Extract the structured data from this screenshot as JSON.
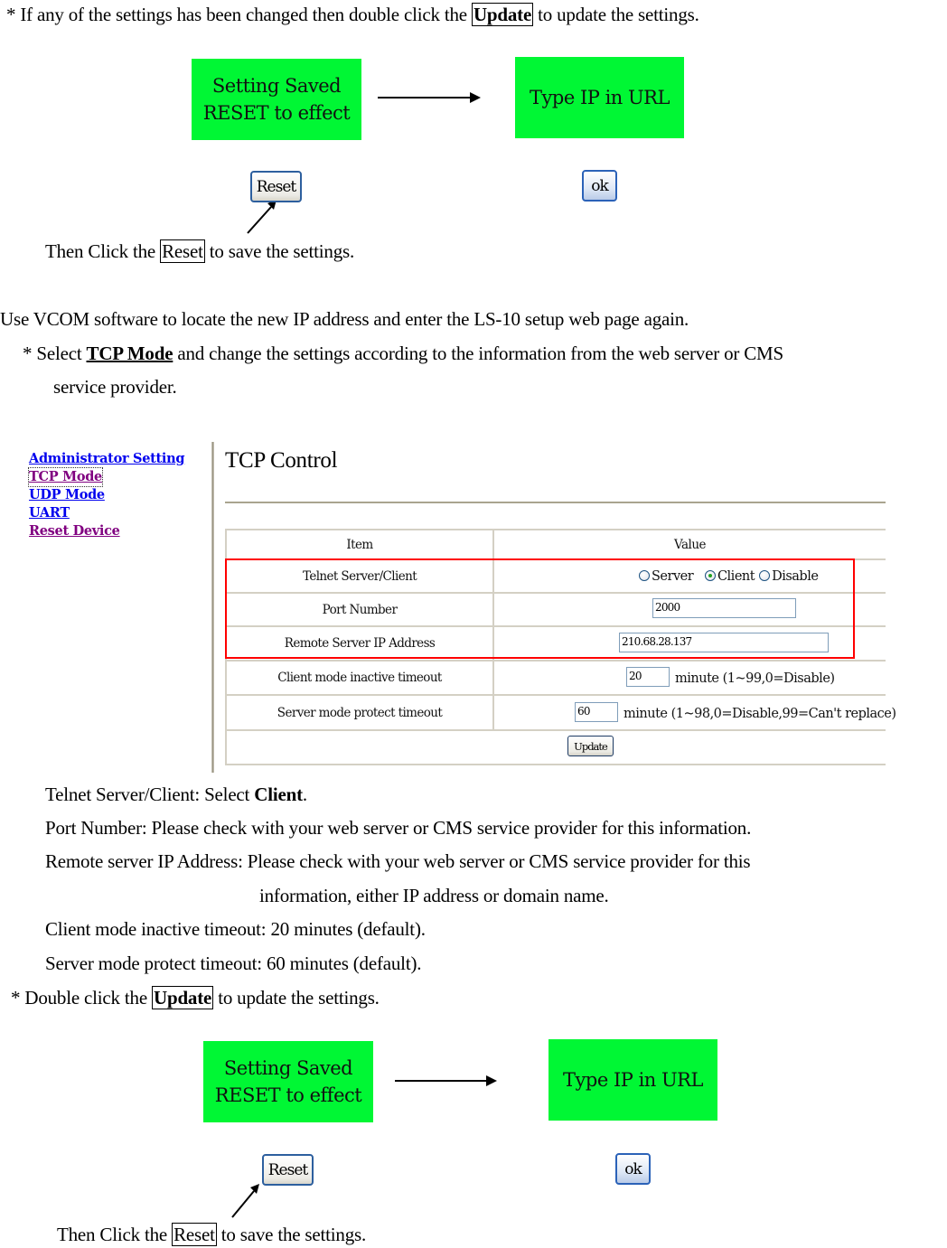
{
  "intro": {
    "prefix": "* If any of the settings has been changed then double click the ",
    "keyword": "Update",
    "suffix": " to update the settings."
  },
  "flow_top": {
    "saved_box": [
      "Setting Saved",
      "RESET to effect"
    ],
    "url_box": "Type IP in URL",
    "reset_button": "Reset",
    "ok_button": "ok",
    "caption_prefix": "Then Click the ",
    "caption_keyword": "Reset",
    "caption_suffix": " to save the settings."
  },
  "vcom": {
    "line1": "Use VCOM software to locate the new IP address and enter the LS-10 setup web page again.",
    "line2_prefix": "* Select ",
    "line2_keyword": "TCP Mode",
    "line2_suffix": " and change the settings according to the information from the web server or CMS",
    "line3": "service provider."
  },
  "webpage": {
    "nav": [
      {
        "label": "Administrator Setting",
        "state": "link"
      },
      {
        "label": "TCP Mode",
        "state": "visited-focused"
      },
      {
        "label": "UDP Mode",
        "state": "link"
      },
      {
        "label": "UART",
        "state": "link"
      },
      {
        "label": "Reset Device",
        "state": "visited"
      }
    ],
    "title": "TCP Control",
    "table": {
      "headers": {
        "item": "Item",
        "value": "Value"
      },
      "rows": [
        {
          "item": "Telnet Server/Client",
          "options": [
            "Server",
            "Client",
            "Disable"
          ],
          "selected": "Client"
        },
        {
          "item": "Port Number",
          "value": "2000"
        },
        {
          "item": "Remote Server IP Address",
          "value": "210.68.28.137"
        },
        {
          "item": "Client mode inactive timeout",
          "value": "20",
          "hint": "minute (1~99,0=Disable)"
        },
        {
          "item": "Server mode protect timeout",
          "value": "60",
          "hint": "minute (1~98,0=Disable,99=Can't replace)"
        }
      ],
      "update_button": "Update"
    },
    "highlight_color": "#ff0000"
  },
  "notes": {
    "telnet_prefix": "Telnet Server/Client: Select ",
    "telnet_keyword": "Client",
    "telnet_suffix": ".",
    "port": "Port Number: Please check with your web server or CMS service provider for this information.",
    "remote1": "Remote server IP Address: Please check with your web server or CMS service provider for this",
    "remote2": "information, either IP address or domain name.",
    "client_timeout": "Client mode inactive timeout: 20 minutes (default).",
    "server_timeout": "Server mode protect timeout: 60 minutes (default).",
    "update_prefix": "* Double click the ",
    "update_keyword": "Update",
    "update_suffix": " to update the settings."
  },
  "flow_bottom": {
    "saved_box": [
      "Setting Saved",
      "RESET to effect"
    ],
    "url_box": "Type IP in URL",
    "reset_button": "Reset",
    "ok_button": "ok",
    "caption_prefix": "Then Click the ",
    "caption_keyword": "Reset",
    "caption_suffix": " to save the settings."
  },
  "colors": {
    "status_green": "#00f734",
    "link_blue": "#0000ee",
    "link_visited": "#800080"
  }
}
